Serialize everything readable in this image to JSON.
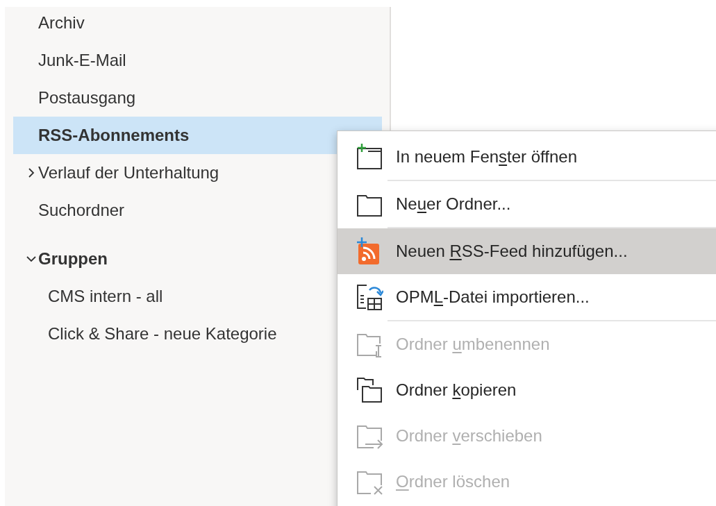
{
  "folders": [
    {
      "kind": "folder",
      "label": "Archiv",
      "selected": false
    },
    {
      "kind": "folder",
      "label": "Junk-E-Mail",
      "selected": false
    },
    {
      "kind": "folder",
      "label": "Postausgang",
      "selected": false
    },
    {
      "kind": "folder",
      "label": "RSS-Abonnements",
      "selected": true
    },
    {
      "kind": "folder",
      "label": "Verlauf der Unterhaltung",
      "selected": false,
      "expanded": false
    },
    {
      "kind": "folder",
      "label": "Suchordner",
      "selected": false
    },
    {
      "kind": "group",
      "label": "Gruppen",
      "selected": false,
      "expanded": true,
      "children": [
        {
          "kind": "folder",
          "label": "CMS intern - all",
          "selected": false
        },
        {
          "kind": "folder",
          "label": "Click & Share - neue Kategorie",
          "selected": false
        }
      ]
    }
  ],
  "context_menu": [
    {
      "before": "In neuem Fen",
      "key": "s",
      "after": "ter öffnen",
      "disabled": false,
      "selected": false,
      "separator_after": true
    },
    {
      "before": "Ne",
      "key": "u",
      "after": "er Ordner...",
      "disabled": false,
      "selected": false,
      "separator_after": true
    },
    {
      "before": "Neuen ",
      "key": "R",
      "after": "SS-Feed hinzufügen...",
      "disabled": false,
      "selected": true,
      "separator_after": false
    },
    {
      "before": "OPM",
      "key": "L",
      "after": "-Datei importieren...",
      "disabled": false,
      "selected": false,
      "separator_after": true
    },
    {
      "before": "Ordner ",
      "key": "u",
      "after": "mbenennen",
      "disabled": true,
      "selected": false,
      "separator_after": false
    },
    {
      "before": "Ordner ",
      "key": "k",
      "after": "opieren",
      "disabled": false,
      "selected": false,
      "separator_after": false
    },
    {
      "before": "Ordner ",
      "key": "v",
      "after": "erschieben",
      "disabled": true,
      "selected": false,
      "separator_after": false
    },
    {
      "key": "O",
      "after": "rdner löschen",
      "disabled": true,
      "selected": false,
      "separator_after": false
    }
  ]
}
